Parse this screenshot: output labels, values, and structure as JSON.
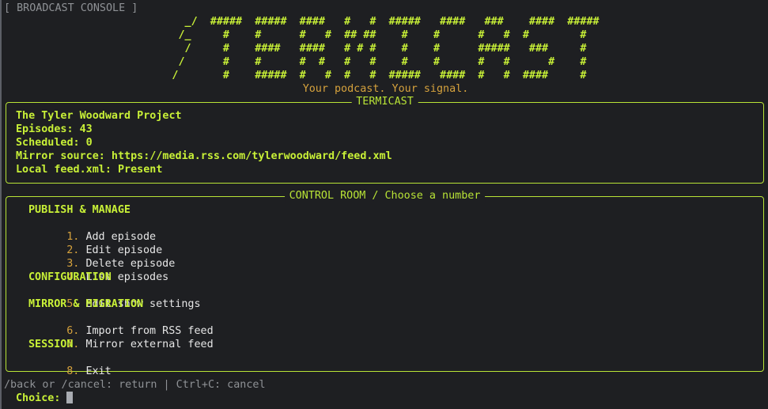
{
  "title_bar": "[ BROADCAST CONSOLE ]",
  "banner_lines": [
    "  _/  #####  #####  ####   #   #  #####   ####   ###    ####  #####",
    " /_     #    #      #   #  ## ##    #    #      #   #  #        #  ",
    "  /     #    ####   ####   # # #    #    #      #####   ###     #  ",
    " /      #    #      #  #   #   #    #    #      #   #      #    #  ",
    "/       #    #####  #   #  #   #  #####   ####  #   #  ####     #  "
  ],
  "tagline": "Your podcast. Your signal.",
  "info_panel": {
    "title": "TERMICAST",
    "lines": [
      "The Tyler Woodward Project",
      "Episodes: 43",
      "Scheduled: 0",
      "Mirror source: https://media.rss.com/tylerwoodward/feed.xml",
      "Local feed.xml: Present"
    ]
  },
  "menu_panel": {
    "title": "CONTROL ROOM / Choose a number",
    "sections": [
      {
        "heading": "PUBLISH & MANAGE",
        "items": [
          {
            "num": "1.",
            "label": "Add episode"
          },
          {
            "num": "2.",
            "label": "Edit episode"
          },
          {
            "num": "3.",
            "label": "Delete episode"
          },
          {
            "num": "4.",
            "label": "List episodes"
          }
        ]
      },
      {
        "heading": "CONFIGURATION",
        "items": [
          {
            "num": "5.",
            "label": "Edit show settings"
          }
        ]
      },
      {
        "heading": "MIRROR & MIGRATION",
        "items": [
          {
            "num": "6.",
            "label": "Import from RSS feed"
          },
          {
            "num": "7.",
            "label": "Mirror external feed"
          }
        ]
      },
      {
        "heading": "SESSION",
        "items": [
          {
            "num": "8.",
            "label": "Exit"
          }
        ]
      }
    ]
  },
  "hint": "/back or /cancel: return | Ctrl+C: cancel",
  "prompt": "Choice:",
  "colors": {
    "accent": "#c8f037",
    "border": "#b9e436",
    "number": "#d6a23d",
    "muted": "#8f9296",
    "background": "#1e1f22"
  }
}
